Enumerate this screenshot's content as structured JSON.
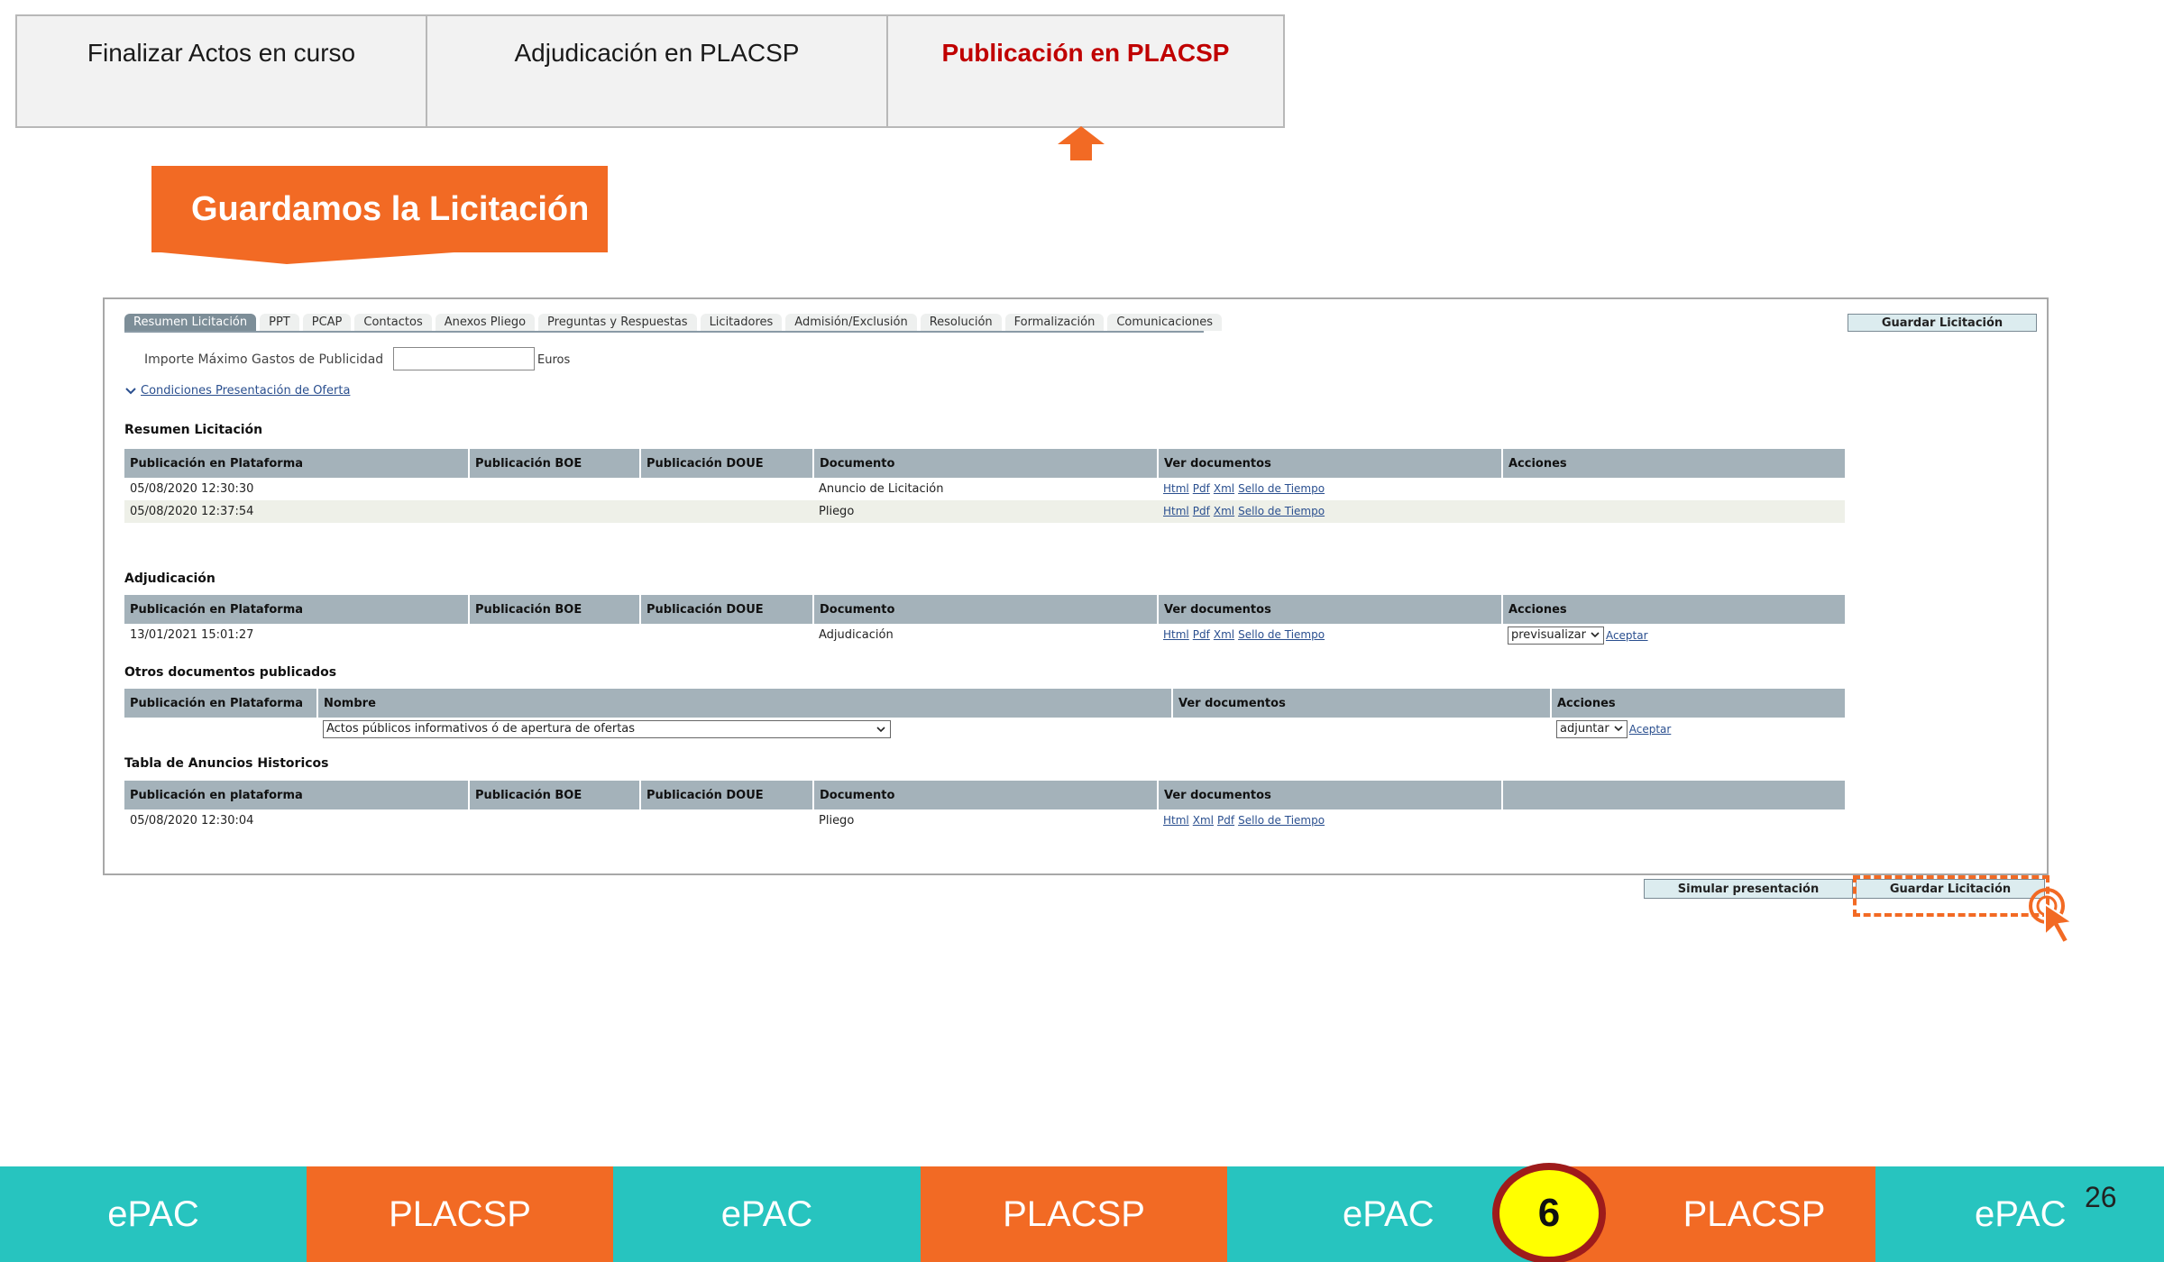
{
  "steps": [
    {
      "label": "Finalizar Actos en curso",
      "active": false
    },
    {
      "label": "Adjudicación en PLACSP",
      "active": false
    },
    {
      "label": "Publicación en PLACSP",
      "active": true
    }
  ],
  "callout": "Guardamos la Licitación",
  "panel": {
    "tabs": [
      "Resumen Licitación",
      "PPT",
      "PCAP",
      "Contactos",
      "Anexos Pliego",
      "Preguntas y Respuestas",
      "Licitadores",
      "Admisión/Exclusión",
      "Resolución",
      "Formalización",
      "Comunicaciones"
    ],
    "active_tab": 0,
    "guardar_top": "Guardar Licitación",
    "importe_label": "Importe Máximo Gastos de Publicidad",
    "importe_value": "",
    "euros": "Euros",
    "condiciones": "Condiciones Presentación de Oferta",
    "resumen": {
      "title": "Resumen Licitación",
      "headers": [
        "Publicación en Plataforma",
        "Publicación BOE",
        "Publicación DOUE",
        "Documento",
        "Ver documentos",
        "Acciones"
      ],
      "rows": [
        {
          "fecha": "05/08/2020 12:30:30",
          "boe": "",
          "doue": "",
          "documento": "Anuncio de Licitación",
          "links": [
            "Html",
            "Pdf",
            "Xml",
            "Sello de Tiempo"
          ]
        },
        {
          "fecha": "05/08/2020 12:37:54",
          "boe": "",
          "doue": "",
          "documento": "Pliego",
          "links": [
            "Html",
            "Pdf",
            "Xml",
            "Sello de Tiempo"
          ]
        }
      ]
    },
    "adjudicacion": {
      "title": "Adjudicación",
      "headers": [
        "Publicación en Plataforma",
        "Publicación BOE",
        "Publicación DOUE",
        "Documento",
        "Ver documentos",
        "Acciones"
      ],
      "row": {
        "fecha": "13/01/2021 15:01:27",
        "documento": "Adjudicación",
        "links": [
          "Html",
          "Pdf",
          "Xml",
          "Sello de Tiempo"
        ],
        "select": "previsualizar",
        "aceptar": "Aceptar"
      }
    },
    "otros": {
      "title": "Otros documentos publicados",
      "headers": [
        "Publicación en Plataforma",
        "Nombre",
        "Ver documentos",
        "Acciones"
      ],
      "nombre_select": "Actos públicos informativos ó de apertura de ofertas",
      "accion_select": "adjuntar",
      "aceptar": "Aceptar"
    },
    "historicos": {
      "title": "Tabla de Anuncios Historicos",
      "headers": [
        "Publicación en plataforma",
        "Publicación BOE",
        "Publicación DOUE",
        "Documento",
        "Ver documentos",
        ""
      ],
      "row": {
        "fecha": "05/08/2020 12:30:04",
        "documento": "Pliego",
        "links": [
          "Html",
          "Xml",
          "Pdf",
          "Sello de Tiempo"
        ]
      }
    }
  },
  "buttons": {
    "simular": "Simular presentación",
    "guardar": "Guardar Licitación"
  },
  "footer": [
    {
      "label": "ePAC",
      "color": "#27c4bf"
    },
    {
      "label": "PLACSP",
      "color": "#f26a24"
    },
    {
      "label": "ePAC",
      "color": "#27c4bf"
    },
    {
      "label": "PLACSP",
      "color": "#f26a24"
    },
    {
      "label": "ePAC",
      "color": "#27c4bf"
    },
    {
      "label": "PLACSP",
      "color": "#f26a24"
    },
    {
      "label": "ePAC",
      "color": "#27c4bf"
    }
  ],
  "badge": "6",
  "page_number": "26",
  "colors": {
    "accent": "#f26a24",
    "teal": "#27c4bf",
    "active_step": "#c00000",
    "header_bg": "#a4b2ba"
  }
}
